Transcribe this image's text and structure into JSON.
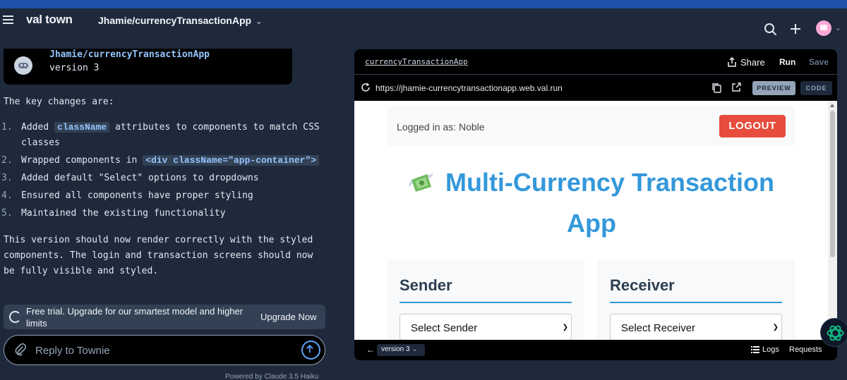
{
  "header": {
    "logo": "val town",
    "project": "Jhamie/currencyTransactionApp"
  },
  "version_card": {
    "title": "Jhamie/currencyTransactionApp",
    "subtitle": "version 3"
  },
  "chat": {
    "intro": "The key changes are:",
    "changes": [
      {
        "num": "1.",
        "pre": "Added ",
        "code": "className",
        "post": " attributes to components to match CSS classes"
      },
      {
        "num": "2.",
        "pre": "Wrapped components in ",
        "code": "<div className=\"app-container\">",
        "post": ""
      },
      {
        "num": "3.",
        "pre": "Added default \"Select\" options to dropdowns",
        "code": "",
        "post": ""
      },
      {
        "num": "4.",
        "pre": "Ensured all components have proper styling",
        "code": "",
        "post": ""
      },
      {
        "num": "5.",
        "pre": "Maintained the existing functionality",
        "code": "",
        "post": ""
      }
    ],
    "outro": "This version should now render correctly with the styled components. The login and transaction screens should now be fully visible and styled."
  },
  "trial": {
    "text": "Free trial. Upgrade for our smartest model and higher limits",
    "upgrade_label": "Upgrade Now"
  },
  "reply": {
    "placeholder": "Reply to Townie"
  },
  "powered_by": "Powered by Claude 3.5 Haiku",
  "preview": {
    "tab": "currencyTransactionApp",
    "share_label": "Share",
    "run_label": "Run",
    "save_label": "Save",
    "url": "https://jhamie-currencytransactionapp.web.val.run",
    "preview_label": "PREVIEW",
    "code_label": "CODE",
    "version_label": "version 3",
    "logs_label": "Logs",
    "requests_label": "Requests"
  },
  "app": {
    "logged_in": "Logged in as: Noble",
    "logout_label": "LOGOUT",
    "title": "Multi-Currency Transaction App",
    "sender_heading": "Sender",
    "receiver_heading": "Receiver",
    "sender_select": "Select Sender",
    "receiver_select": "Select Receiver"
  },
  "colors": {
    "accent": "#3498db",
    "logout": "#e74c3c",
    "background": "#1e293b"
  }
}
